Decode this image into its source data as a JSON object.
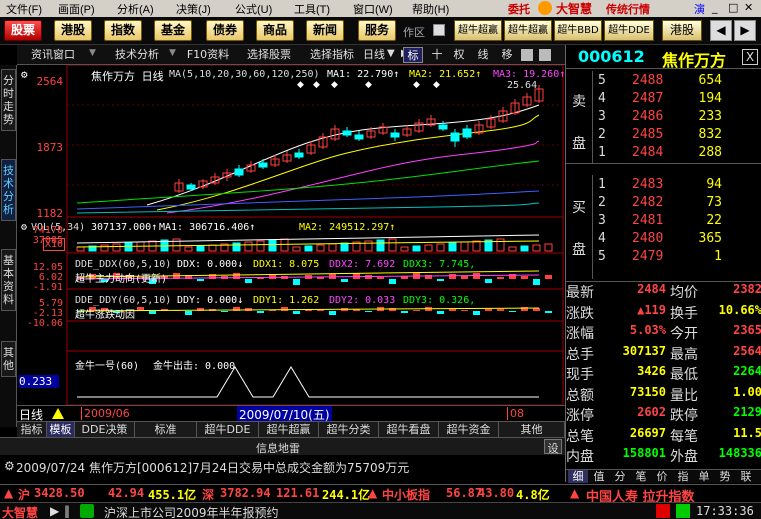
{
  "menu": [
    "文件(F)",
    "画面(P)",
    "分析(A)",
    "决策(J)",
    "公式(U)",
    "工具(T)",
    "窗口(W)",
    "帮助(H)"
  ],
  "brand": {
    "entrust": "委托",
    "name": "大智慧",
    "slogan": "传统行情",
    "demo": "演"
  },
  "toolbar": {
    "stock": "股票",
    "hk": "港股",
    "index": "指数",
    "fund": "基金",
    "bond": "债券",
    "goods": "商品",
    "news": "新闻",
    "service": "服务",
    "zone": "作区",
    "s1": "超牛超赢",
    "s2": "超牛超赢",
    "s3": "超牛BBD",
    "s4": "超牛DDE",
    "s5": "港股"
  },
  "tabs": {
    "info": "资讯窗口",
    "tech": "技术分析",
    "f10": "F10资料",
    "pick": "选择股票",
    "ind": "选择指标",
    "day": "日线",
    "mark": "标",
    "ten": "十",
    "right": "权",
    "line": "线",
    "move": "移"
  },
  "sidebar": [
    "分时走势",
    "技术分析",
    "基本资料",
    "其他"
  ],
  "chart": {
    "title": "焦作万方 日线",
    "ma_label": "MA(5,10,20,30,60,120,250)",
    "ma1": "MA1: 22.790↑",
    "ma2": "MA2: 21.652↑",
    "ma3": "MA3: 19.260↑",
    "high_mark": "25.64",
    "y_top": "2564",
    "y_mid": "1873",
    "y_bot": "1182",
    "vol_label": "VOL(5,34)",
    "vol_val": "307137.000↑",
    "vol_ma1": "MA1: 306716.406↑",
    "vol_ma2": "MA2: 249512.297↑",
    "vol_y1": "74170",
    "vol_y2": "37085",
    "vol_unit": "X10",
    "ddx_label": "DDE_DDX(60,5,10)",
    "ddx_val": "DDX: 0.000↓",
    "ddx1": "DDX1: 8.075",
    "ddx2": "DDX2: 7.692",
    "ddx3": "DDX3: 7.745,",
    "ddx_sub": "超牛主力动向(更新)",
    "ddx_y1": "12.05",
    "ddx_y2": "6.02",
    "ddx_y3": "-1.91",
    "ddy_label": "DDE_DDY(60,5,10)",
    "ddy_val": "DDY: 0.000↓",
    "ddy1": "DDY1: 1.262",
    "ddy2": "DDY2: 0.033",
    "ddy3": "DDY3: 0.326,",
    "ddy_sub": "超牛涨跌动因",
    "ddy_y1": "5.79",
    "ddy_y2": "-2.13",
    "ddy_y3": "-10.06",
    "jn_label": "金牛一号(60)",
    "jn_val": "金牛出击: 0.000",
    "jn_y": "0.233"
  },
  "dates": {
    "period": "日线",
    "d1": "2009/06",
    "d2": "2009/07/10(五)",
    "d3": "08"
  },
  "btabs": [
    "指标",
    "模板",
    "DDE决策",
    "标准",
    "超牛DDE",
    "超牛超赢",
    "超牛分类",
    "超牛看盘",
    "超牛资金",
    "其他"
  ],
  "info_bar": "信息地雷",
  "settings": "设",
  "news": "2009/07/24 焦作万方[000612]7月24日交易中总成交金额为75709万元",
  "quote": {
    "code": "000612",
    "name": "焦作万方",
    "close": "X",
    "sell": [
      {
        "lv": "5",
        "p": "2488",
        "v": "654"
      },
      {
        "lv": "4",
        "p": "2487",
        "v": "194"
      },
      {
        "lv": "3",
        "p": "2486",
        "v": "233"
      },
      {
        "lv": "2",
        "p": "2485",
        "v": "832"
      },
      {
        "lv": "1",
        "p": "2484",
        "v": "288"
      }
    ],
    "buy": [
      {
        "lv": "1",
        "p": "2483",
        "v": "94"
      },
      {
        "lv": "2",
        "p": "2482",
        "v": "73"
      },
      {
        "lv": "3",
        "p": "2481",
        "v": "22"
      },
      {
        "lv": "4",
        "p": "2480",
        "v": "365"
      },
      {
        "lv": "5",
        "p": "2479",
        "v": "1"
      }
    ],
    "sell_label": [
      "卖",
      "盘"
    ],
    "buy_label": [
      "买",
      "盘"
    ],
    "stats": [
      {
        "l": "最新",
        "v": "2484",
        "l2": "均价",
        "v2": "2382"
      },
      {
        "l": "涨跌",
        "v": "▲119",
        "l2": "换手",
        "v2": "10.66%"
      },
      {
        "l": "涨幅",
        "v": "5.03%",
        "l2": "今开",
        "v2": "2365"
      },
      {
        "l": "总手",
        "v": "307137",
        "l2": "最高",
        "v2": "2564"
      },
      {
        "l": "现手",
        "v": "3426",
        "l2": "最低",
        "v2": "2264"
      },
      {
        "l": "总额",
        "v": "73150",
        "l2": "量比",
        "v2": "1.00"
      },
      {
        "l": "涨停",
        "v": "2602",
        "l2": "跌停",
        "v2": "2129"
      },
      {
        "l": "总笔",
        "v": "26697",
        "l2": "每笔",
        "v2": "11.5"
      },
      {
        "l": "内盘",
        "v": "158801",
        "l2": "外盘",
        "v2": "148336"
      }
    ],
    "tabs": [
      "细",
      "值",
      "分",
      "笔",
      "价",
      "指",
      "单",
      "势",
      "联"
    ]
  },
  "ticker": {
    "sh": "沪",
    "sh_idx": "3428.50",
    "sh_chg": "42.94",
    "sh_amt": "455.1亿",
    "sz": "深",
    "sz_idx": "3782.94",
    "sz_chg": "121.61",
    "sz_amt": "244.1亿",
    "zx": "中小板指",
    "zx_idx": "56.87",
    "zx_amt": "43.80",
    "zx_amt2": "4.8亿",
    "ad": "中国人寿 拉升指数"
  },
  "status": {
    "brand": "大智慧",
    "text": "沪深上市公司2009年半年报预约",
    "time": "17:33:36"
  },
  "colors": {
    "red": "#ff4040",
    "green": "#00e000",
    "cyan": "#00ffff",
    "yellow": "#ffff00",
    "magenta": "#ff40ff",
    "white": "#ffffff"
  }
}
